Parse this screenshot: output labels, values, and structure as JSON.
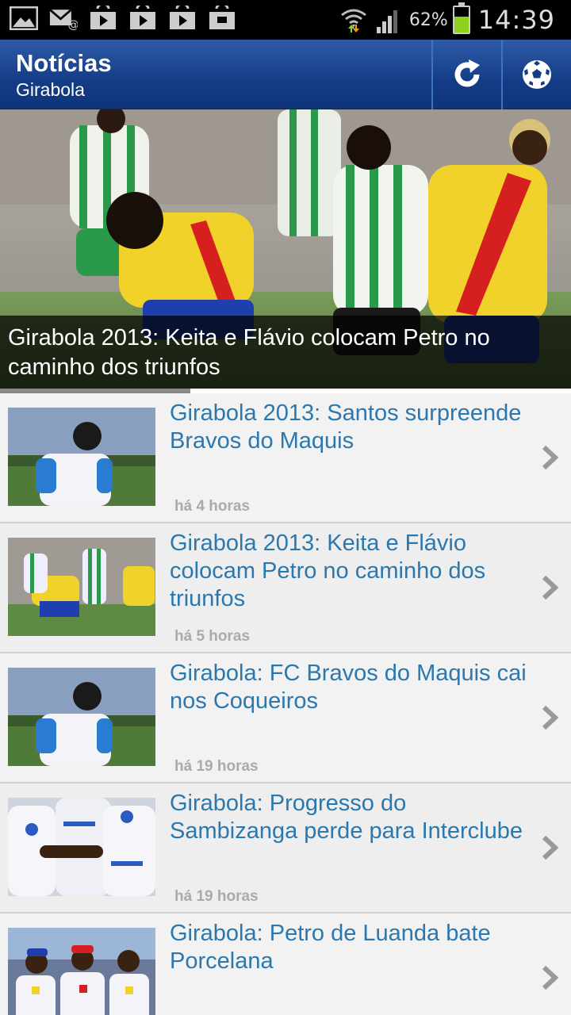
{
  "status_bar": {
    "battery": "62%",
    "time": "14:39"
  },
  "app_bar": {
    "title": "Notícias",
    "subtitle": "Girabola",
    "refresh_icon": "refresh-icon",
    "ball_icon": "soccer-ball-icon"
  },
  "hero": {
    "caption": "Girabola 2013: Keita e Flávio colocam Petro no caminho dos triunfos",
    "slide_progress": 0.333
  },
  "news": [
    {
      "title": "Girabola 2013: Santos surpreende Bravos do Maquis",
      "time": "há 4 horas",
      "thumb": "player-back"
    },
    {
      "title": "Girabola 2013: Keita e Flávio colocam Petro no caminho dos triunfos",
      "time": "há 5 horas",
      "thumb": "match"
    },
    {
      "title": "Girabola: FC Bravos do Maquis cai nos Coqueiros",
      "time": "há 19 horas",
      "thumb": "player-back"
    },
    {
      "title": "Girabola: Progresso do Sambizanga perde para Interclube",
      "time": "há 19 horas",
      "thumb": "team-white"
    },
    {
      "title": "Girabola: Petro de Luanda bate Porcelana",
      "time": "",
      "thumb": "bench"
    }
  ]
}
